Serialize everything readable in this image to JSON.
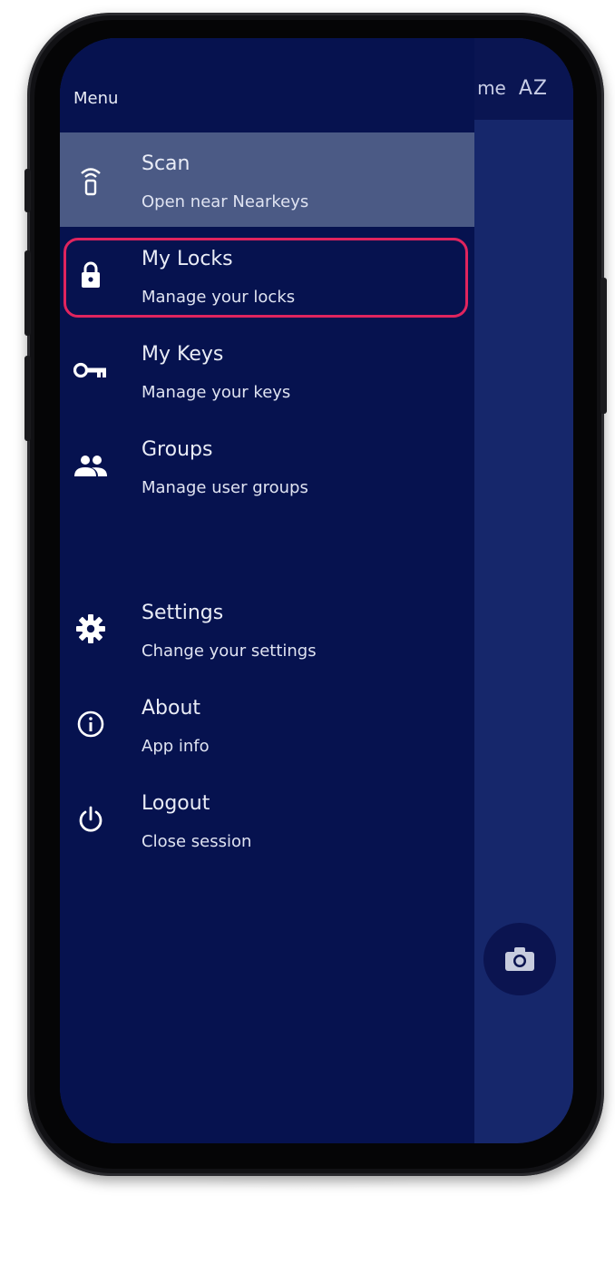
{
  "topbar": {
    "partial_text": "me",
    "sort_icon": "sort-az-icon",
    "sort_label": "AZ"
  },
  "drawer": {
    "title": "Menu",
    "items": [
      {
        "icon": "remote-icon",
        "label": "Scan",
        "sub": "Open near Nearkeys",
        "selected": true
      },
      {
        "icon": "lock-icon",
        "label": "My Locks",
        "sub": "Manage your locks",
        "highlighted": true
      },
      {
        "icon": "key-icon",
        "label": "My Keys",
        "sub": "Manage your keys"
      },
      {
        "icon": "people-icon",
        "label": "Groups",
        "sub": "Manage user groups"
      },
      {
        "icon": "gear-icon",
        "label": "Settings",
        "sub": "Change your settings"
      },
      {
        "icon": "info-icon",
        "label": "About",
        "sub": "App info"
      },
      {
        "icon": "power-icon",
        "label": "Logout",
        "sub": "Close session"
      }
    ]
  },
  "fab": {
    "icon": "camera-icon"
  },
  "colors": {
    "drawer_bg": "#06124f",
    "app_bg": "#16276b",
    "selected_bg": "#4b5a85",
    "highlight": "#e0245e"
  }
}
